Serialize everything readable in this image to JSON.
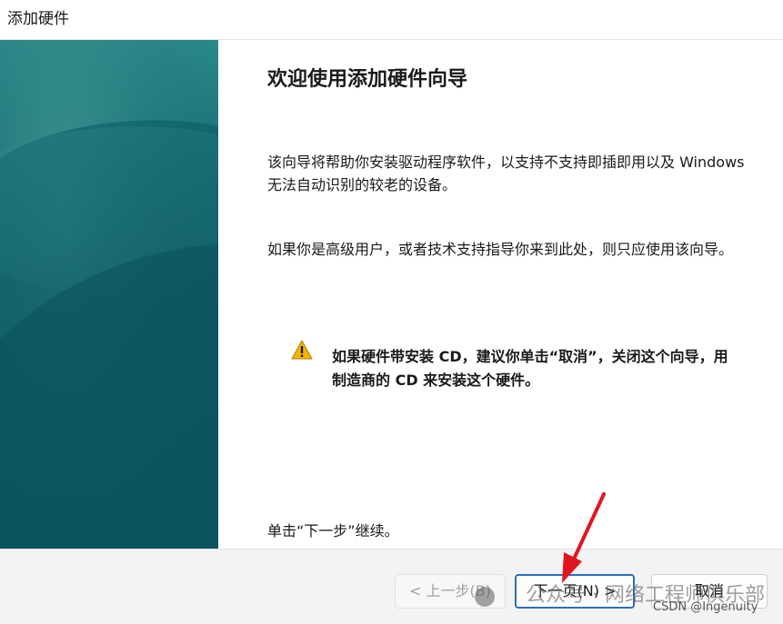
{
  "window": {
    "title": "添加硬件"
  },
  "wizard": {
    "heading": "欢迎使用添加硬件向导",
    "paragraph1": "该向导将帮助你安装驱动程序软件，以支持不支持即插即用以及 Windows 无法自动识别的较老的设备。",
    "paragraph2": "如果你是高级用户，或者技术支持指导你来到此处，则只应使用该向导。",
    "warning": "如果硬件带安装 CD，建议你单击“取消”，关闭这个向导，用制造商的 CD 来安装这个硬件。",
    "continue_hint": "单击“下一步”继续。"
  },
  "buttons": {
    "back": "< 上一步(B)",
    "next": "下一页(N) >",
    "cancel": "取消"
  },
  "overlay": {
    "watermark": "公众号 · 网络工程师俱乐部",
    "credit": "CSDN @Ingenuity"
  },
  "icons": {
    "warning": "warning-icon",
    "arrow": "red-arrow-annotation"
  },
  "colors": {
    "panel_teal": "#176e73",
    "focus_border": "#2c6fb8",
    "warning_yellow": "#f2b600",
    "annotation_red": "#e0161e"
  }
}
